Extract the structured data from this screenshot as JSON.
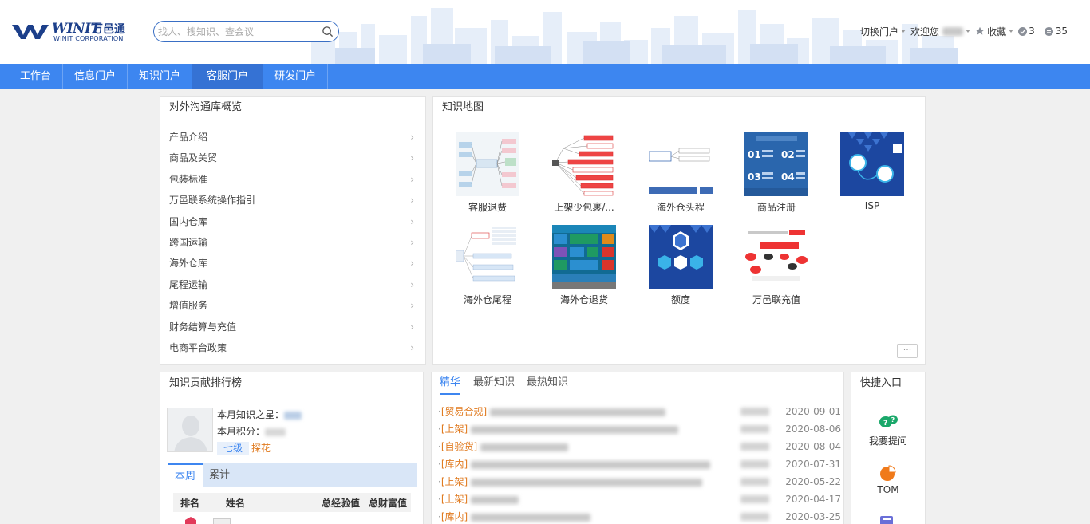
{
  "header": {
    "logo_en": "WINIT",
    "logo_cn": "万邑通",
    "logo_sub": "WINIT CORPORATION",
    "search_placeholder": "找人、搜知识、查会议",
    "switch_portal": "切换门户",
    "welcome": "欢迎您",
    "favorites": "收藏",
    "count_a": "3",
    "count_b": "35"
  },
  "nav": {
    "tabs": [
      "工作台",
      "信息门户",
      "知识门户",
      "客服门户",
      "研发门户"
    ],
    "active_index": 3
  },
  "overview": {
    "title": "对外沟通库概览",
    "items": [
      "产品介绍",
      "商品及关贸",
      "包装标准",
      "万邑联系统操作指引",
      "国内仓库",
      "跨国运输",
      "海外仓库",
      "尾程运输",
      "增值服务",
      "财务结算与充值",
      "电商平台政策"
    ]
  },
  "knowledge_map": {
    "title": "知识地图",
    "items": [
      {
        "label": "客服退费",
        "thumb": "mindmap-light"
      },
      {
        "label": "上架少包裹/...",
        "thumb": "mindmap-red"
      },
      {
        "label": "海外仓头程",
        "thumb": "flow-blue"
      },
      {
        "label": "商品注册",
        "thumb": "grid-blue"
      },
      {
        "label": "ISP",
        "thumb": "hex-blue"
      },
      {
        "label": "海外仓尾程",
        "thumb": "mindmap-blue"
      },
      {
        "label": "海外仓退货",
        "thumb": "tiles-color"
      },
      {
        "label": "额度",
        "thumb": "hex-blue-2"
      },
      {
        "label": "万邑联充值",
        "thumb": "flow-red"
      }
    ],
    "more": "···"
  },
  "ranking": {
    "title": "知识贡献排行榜",
    "star_label": "本月知识之星：",
    "points_label": "本月积分：",
    "level": "七级",
    "level_title": "探花",
    "tabs": [
      "本周",
      "累计"
    ],
    "columns": [
      "排名",
      "姓名",
      "总经验值",
      "总财富值"
    ]
  },
  "news": {
    "tabs": [
      "精华",
      "最新知识",
      "最热知识"
    ],
    "rows": [
      {
        "cat": "[贸易合规]",
        "date": "2020-09-01"
      },
      {
        "cat": "[上架]",
        "date": "2020-08-06"
      },
      {
        "cat": "[自验货]",
        "date": "2020-08-04"
      },
      {
        "cat": "[库内]",
        "date": "2020-07-31"
      },
      {
        "cat": "[上架]",
        "date": "2020-05-22"
      },
      {
        "cat": "[上架]",
        "date": "2020-04-17"
      },
      {
        "cat": "[库内]",
        "date": "2020-03-25"
      }
    ]
  },
  "quick": {
    "title": "快捷入口",
    "items": [
      "我要提问",
      "TOM"
    ]
  },
  "colors": {
    "brand": "#1c3f8a",
    "nav": "#3d86f0",
    "accent_orange": "#e07a1f"
  }
}
